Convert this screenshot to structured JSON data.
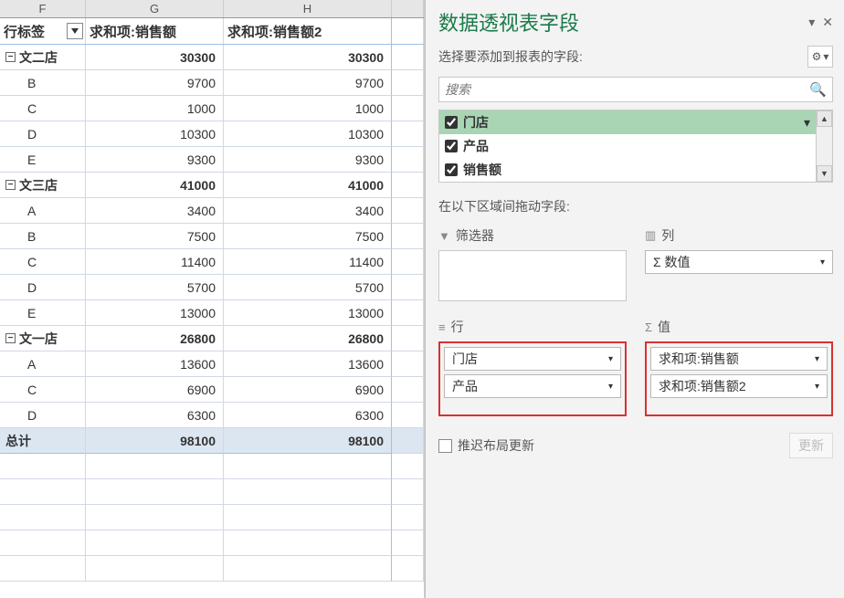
{
  "columns": {
    "F": "F",
    "G": "G",
    "H": "H",
    "I": ""
  },
  "pivot_headers": {
    "rowlabel": "行标签",
    "sum1": "求和项:销售额",
    "sum2": "求和项:销售额2"
  },
  "rows": [
    {
      "type": "group",
      "label": "文二店",
      "v1": "30300",
      "v2": "30300"
    },
    {
      "type": "item",
      "label": "B",
      "v1": "9700",
      "v2": "9700"
    },
    {
      "type": "item",
      "label": "C",
      "v1": "1000",
      "v2": "1000"
    },
    {
      "type": "item",
      "label": "D",
      "v1": "10300",
      "v2": "10300"
    },
    {
      "type": "item",
      "label": "E",
      "v1": "9300",
      "v2": "9300"
    },
    {
      "type": "group",
      "label": "文三店",
      "v1": "41000",
      "v2": "41000"
    },
    {
      "type": "item",
      "label": "A",
      "v1": "3400",
      "v2": "3400"
    },
    {
      "type": "item",
      "label": "B",
      "v1": "7500",
      "v2": "7500"
    },
    {
      "type": "item",
      "label": "C",
      "v1": "11400",
      "v2": "11400"
    },
    {
      "type": "item",
      "label": "D",
      "v1": "5700",
      "v2": "5700"
    },
    {
      "type": "item",
      "label": "E",
      "v1": "13000",
      "v2": "13000"
    },
    {
      "type": "group",
      "label": "文一店",
      "v1": "26800",
      "v2": "26800"
    },
    {
      "type": "item",
      "label": "A",
      "v1": "13600",
      "v2": "13600"
    },
    {
      "type": "item",
      "label": "C",
      "v1": "6900",
      "v2": "6900"
    },
    {
      "type": "item",
      "label": "D",
      "v1": "6300",
      "v2": "6300"
    }
  ],
  "grand": {
    "label": "总计",
    "v1": "98100",
    "v2": "98100"
  },
  "panel": {
    "title": "数据透视表字段",
    "choose": "选择要添加到报表的字段:",
    "search_ph": "搜索",
    "fields": [
      {
        "name": "门店",
        "checked": true,
        "selected": true
      },
      {
        "name": "产品",
        "checked": true,
        "selected": false
      },
      {
        "name": "销售额",
        "checked": true,
        "selected": false
      }
    ],
    "drag_hint": "在以下区域间拖动字段:",
    "areas": {
      "filters": "筛选器",
      "columns": "列",
      "rows": "行",
      "values": "值"
    },
    "columns_items": [
      "Σ 数值"
    ],
    "rows_items": [
      "门店",
      "产品"
    ],
    "values_items": [
      "求和项:销售额",
      "求和项:销售额2"
    ],
    "defer": "推迟布局更新",
    "update": "更新"
  }
}
